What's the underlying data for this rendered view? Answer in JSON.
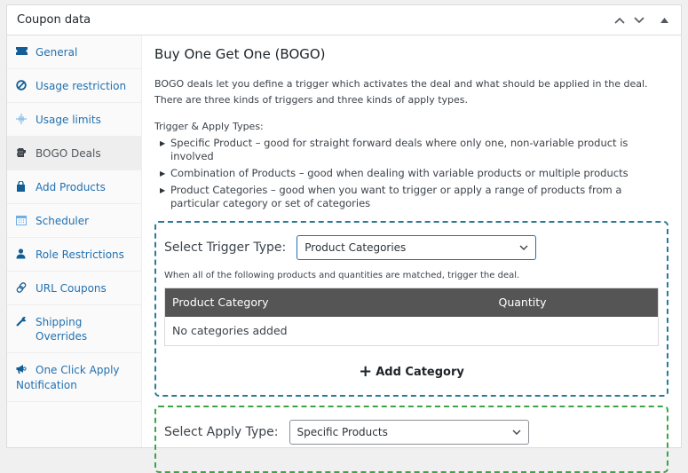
{
  "panel": {
    "title": "Coupon data",
    "controls": [
      {
        "name": "move-up-icon",
        "glyph": "⌃"
      },
      {
        "name": "move-down-icon",
        "glyph": "⌄"
      },
      {
        "name": "toggle-panel-icon",
        "glyph": "▲"
      }
    ]
  },
  "sidebar": {
    "items": [
      {
        "label": "General",
        "icon": "ticket-icon",
        "active": false
      },
      {
        "label": "Usage restriction",
        "icon": "block-icon",
        "active": false
      },
      {
        "label": "Usage limits",
        "icon": "limits-icon",
        "active": false
      },
      {
        "label": "BOGO Deals",
        "icon": "bogo-icon",
        "active": true
      },
      {
        "label": "Add Products",
        "icon": "bag-icon",
        "active": false
      },
      {
        "label": "Scheduler",
        "icon": "calendar-icon",
        "active": false
      },
      {
        "label": "Role Restrictions",
        "icon": "user-icon",
        "active": false
      },
      {
        "label": "URL Coupons",
        "icon": "link-icon",
        "active": false
      },
      {
        "label": "Shipping Overrides",
        "icon": "wrench-icon",
        "active": false
      },
      {
        "label": "One Click Apply Notification",
        "icon": "megaphone-icon",
        "active": false
      }
    ]
  },
  "main": {
    "title": "Buy One Get One (BOGO)",
    "description": "BOGO deals let you define a trigger which activates the deal and what should be applied in the deal. There are three kinds of triggers and three kinds of apply types.",
    "types_title": "Trigger & Apply Types:",
    "types": [
      "Specific Product – good for straight forward deals where only one, non-variable product is involved",
      "Combination of Products – good when dealing with variable products or multiple products",
      "Product Categories – good when you want to trigger or apply a range of products from a particular category or set of categories"
    ],
    "trigger": {
      "label": "Select Trigger Type:",
      "selected": "Product Categories",
      "hint": "When all of the following products and quantities are matched, trigger the deal.",
      "table": {
        "headers": [
          "Product Category",
          "Quantity"
        ],
        "empty": "No categories added"
      },
      "add_button": "Add Category"
    },
    "apply": {
      "label": "Select Apply Type:",
      "selected": "Specific Products"
    }
  },
  "colors": {
    "link": "#2271b1",
    "trigger_border": "#2b7a97",
    "apply_border": "#3aa547",
    "table_header": "#555555"
  }
}
